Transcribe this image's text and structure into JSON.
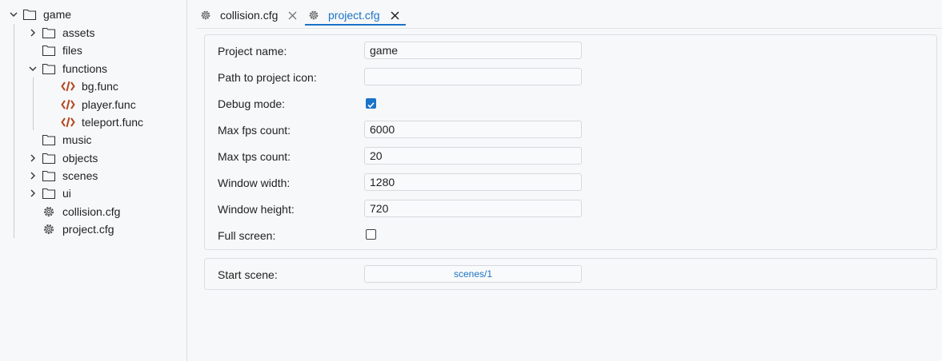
{
  "sidebar": {
    "root": {
      "label": "game",
      "icon": "folder-icon",
      "expanded": true
    },
    "items": [
      {
        "label": "assets",
        "icon": "folder-icon",
        "chevron": "right"
      },
      {
        "label": "files",
        "icon": "folder-icon",
        "chevron": "none"
      },
      {
        "label": "functions",
        "icon": "folder-icon",
        "chevron": "down"
      },
      {
        "label": "bg.func",
        "icon": "code-icon",
        "chevron": "none"
      },
      {
        "label": "player.func",
        "icon": "code-icon",
        "chevron": "none"
      },
      {
        "label": "teleport.func",
        "icon": "code-icon",
        "chevron": "none"
      },
      {
        "label": "music",
        "icon": "folder-icon",
        "chevron": "none"
      },
      {
        "label": "objects",
        "icon": "folder-icon",
        "chevron": "right"
      },
      {
        "label": "scenes",
        "icon": "folder-icon",
        "chevron": "right"
      },
      {
        "label": "ui",
        "icon": "folder-icon",
        "chevron": "right"
      },
      {
        "label": "collision.cfg",
        "icon": "gear-icon",
        "chevron": "none"
      },
      {
        "label": "project.cfg",
        "icon": "gear-icon",
        "chevron": "none"
      }
    ]
  },
  "tabs": [
    {
      "label": "collision.cfg",
      "active": false
    },
    {
      "label": "project.cfg",
      "active": true
    }
  ],
  "form": {
    "project_name": {
      "label": "Project name:",
      "value": "game"
    },
    "icon_path": {
      "label": "Path to project icon:",
      "value": ""
    },
    "debug_mode": {
      "label": "Debug mode:",
      "checked": true
    },
    "max_fps": {
      "label": "Max fps count:",
      "value": "6000"
    },
    "max_tps": {
      "label": "Max tps count:",
      "value": "20"
    },
    "window_width": {
      "label": "Window width:",
      "value": "1280"
    },
    "window_height": {
      "label": "Window height:",
      "value": "720"
    },
    "full_screen": {
      "label": "Full screen:",
      "checked": false
    }
  },
  "start_scene": {
    "label": "Start scene:",
    "value": "scenes/1"
  },
  "colors": {
    "accent": "#1a73c8",
    "code_icon": "#b3471f",
    "background": "#f7f8f9"
  }
}
